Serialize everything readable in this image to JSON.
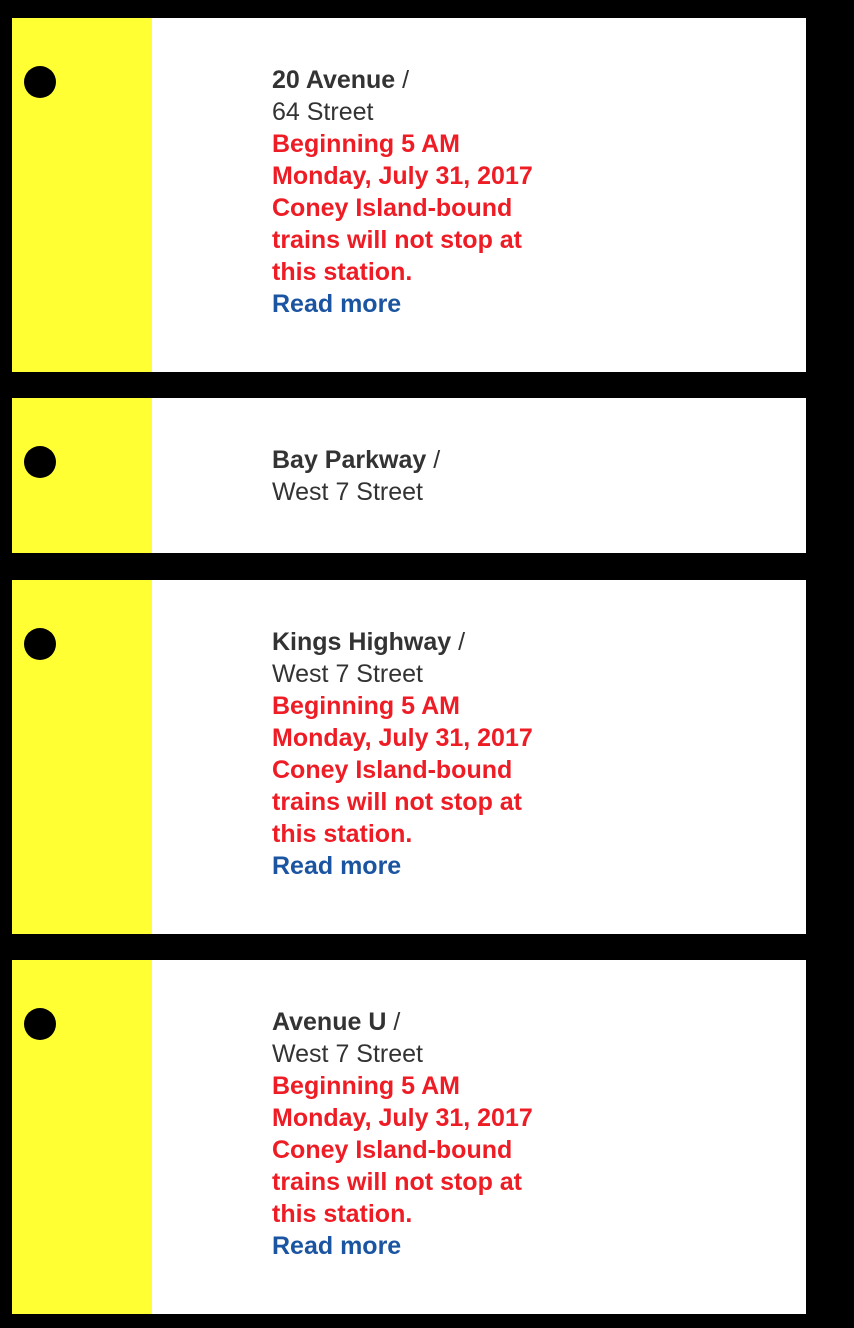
{
  "colors": {
    "line": "#ffff33",
    "alert": "#ee1c25",
    "link": "#1b54a0",
    "background": "#000000"
  },
  "stations": [
    {
      "primary": "20 Avenue",
      "separator": "/",
      "secondary": "64 Street",
      "alert": "Beginning 5 AM Monday, July 31, 2017 Coney Island-bound trains will not stop at this station.",
      "link": "Read more"
    },
    {
      "primary": "Bay Parkway",
      "separator": "/",
      "secondary": "West 7 Street"
    },
    {
      "primary": "Kings Highway",
      "separator": "/",
      "secondary": "West 7 Street",
      "alert": "Beginning 5 AM Monday, July 31, 2017 Coney Island-bound trains will not stop at this station.",
      "link": "Read more"
    },
    {
      "primary": "Avenue U",
      "separator": "/",
      "secondary": "West 7 Street",
      "alert": "Beginning 5 AM Monday, July 31, 2017 Coney Island-bound trains will not stop at this station.",
      "link": "Read more"
    }
  ]
}
